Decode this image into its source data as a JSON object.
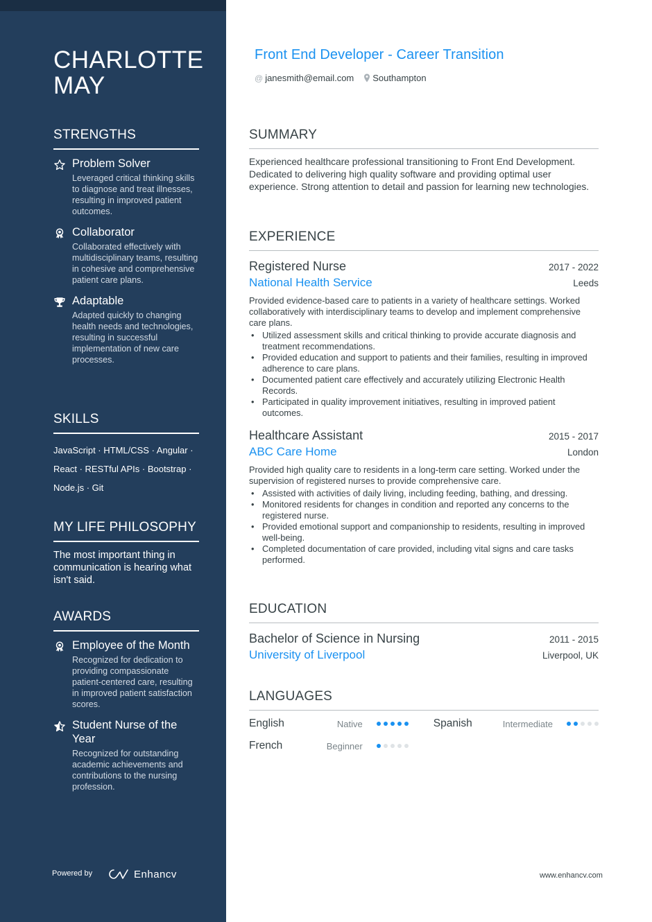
{
  "name": {
    "line1": "CHARLOTTE",
    "line2": "MAY"
  },
  "headline": "Front End Developer - Career Transition",
  "contacts": {
    "email": "janesmith@email.com",
    "email_icon": "at-icon",
    "location": "Southampton",
    "location_icon": "map-pin-icon"
  },
  "colors": {
    "sidebar": "#233e5c",
    "accent": "#1a91f0",
    "text": "#384347"
  },
  "sidebar": {
    "strengths": {
      "title": "STRENGTHS",
      "items": [
        {
          "icon": "star-outline-icon",
          "title": "Problem Solver",
          "desc": "Leveraged critical thinking skills to diagnose and treat illnesses, resulting in improved patient outcomes."
        },
        {
          "icon": "medal-icon",
          "title": "Collaborator",
          "desc": "Collaborated effectively with multidisciplinary teams, resulting in cohesive and comprehensive patient care plans."
        },
        {
          "icon": "trophy-icon",
          "title": "Adaptable",
          "desc": "Adapted quickly to changing health needs and technologies, resulting in successful implementation of new care processes."
        }
      ]
    },
    "skills": {
      "title": "SKILLS",
      "lines": [
        "JavaScript · HTML/CSS · Angular ·",
        "React · RESTful APIs · Bootstrap ·",
        "Node.js · Git"
      ],
      "items": [
        "JavaScript",
        "HTML/CSS",
        "Angular",
        "React",
        "RESTful APIs",
        "Bootstrap",
        "Node.js",
        "Git"
      ]
    },
    "philosophy": {
      "title": "MY LIFE PHILOSOPHY",
      "text": "The most important thing in communication is hearing what isn't said."
    },
    "awards": {
      "title": "AWARDS",
      "items": [
        {
          "icon": "medal-icon",
          "title": "Employee of the Month",
          "desc": "Recognized for dedication to providing compassionate patient-centered care, resulting in improved patient satisfaction scores."
        },
        {
          "icon": "star-half-icon",
          "title": "Student Nurse of the Year",
          "desc": "Recognized for outstanding academic achievements and contributions to the nursing profession."
        }
      ]
    },
    "powered_by": "Powered by",
    "brand": "Enhancv"
  },
  "summary": {
    "title": "SUMMARY",
    "text": "Experienced healthcare professional transitioning to Front End Development. Dedicated to delivering high quality software and providing optimal user experience. Strong attention to detail and passion for learning new technologies."
  },
  "experience": {
    "title": "EXPERIENCE",
    "jobs": [
      {
        "title": "Registered Nurse",
        "dates": "2017 - 2022",
        "company": "National Health Service",
        "location": "Leeds",
        "desc": "Provided evidence-based care to patients in a variety of healthcare settings. Worked collaboratively with interdisciplinary teams to develop and implement comprehensive care plans.",
        "bullets": [
          "Utilized assessment skills and critical thinking to provide accurate diagnosis and treatment recommendations.",
          "Provided education and support to patients and their families, resulting in improved adherence to care plans.",
          "Documented patient care effectively and accurately utilizing Electronic Health Records.",
          "Participated in quality improvement initiatives, resulting in improved patient outcomes."
        ]
      },
      {
        "title": "Healthcare Assistant",
        "dates": "2015 - 2017",
        "company": "ABC Care Home",
        "location": "London",
        "desc": "Provided high quality care to residents in a long-term care setting. Worked under the supervision of registered nurses to provide comprehensive care.",
        "bullets": [
          "Assisted with activities of daily living, including feeding, bathing, and dressing.",
          "Monitored residents for changes in condition and reported any concerns to the registered nurse.",
          "Provided emotional support and companionship to residents, resulting in improved well-being.",
          "Completed documentation of care provided, including vital signs and care tasks performed."
        ]
      }
    ]
  },
  "education": {
    "title": "EDUCATION",
    "items": [
      {
        "degree": "Bachelor of Science in Nursing",
        "dates": "2011 - 2015",
        "school": "University of Liverpool",
        "location": "Liverpool, UK"
      }
    ]
  },
  "languages": {
    "title": "LANGUAGES",
    "items": [
      {
        "name": "English",
        "level": "Native",
        "rating": 5,
        "max": 5
      },
      {
        "name": "Spanish",
        "level": "Intermediate",
        "rating": 2,
        "max": 5
      },
      {
        "name": "French",
        "level": "Beginner",
        "rating": 1,
        "max": 5
      }
    ]
  },
  "footer": {
    "site": "www.enhancv.com"
  }
}
